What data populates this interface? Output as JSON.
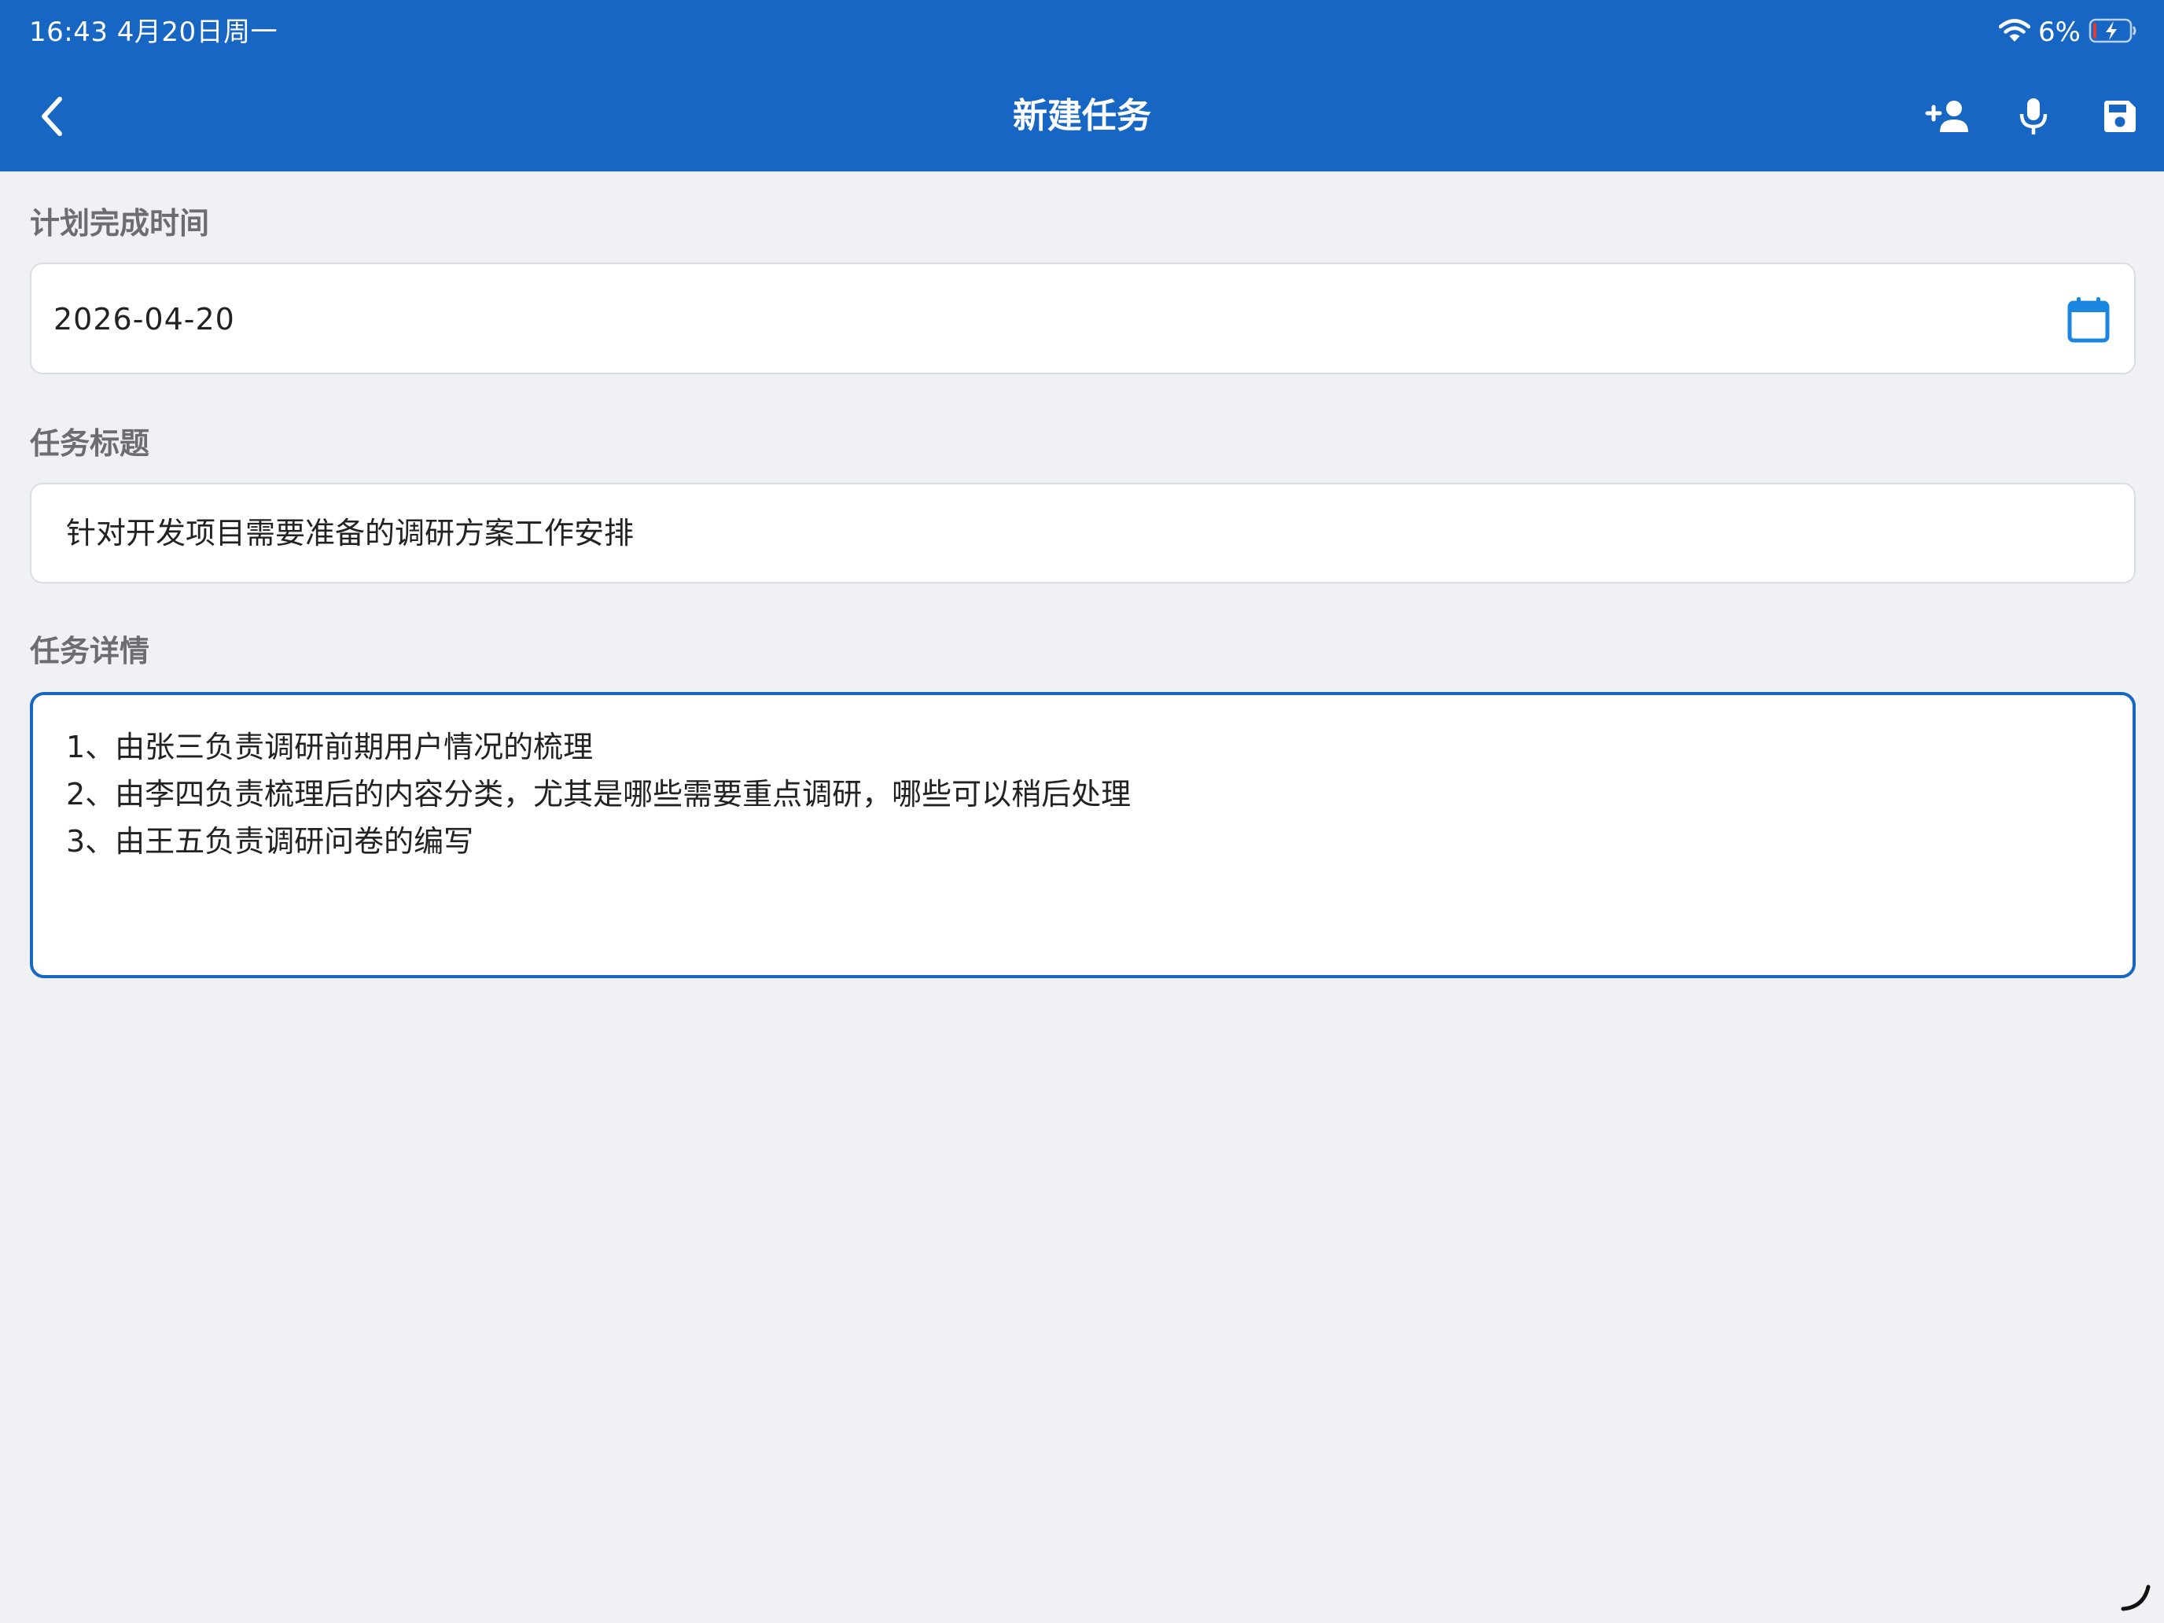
{
  "status_bar": {
    "time_date": "16:43   4月20日周一",
    "battery_percent": "6%",
    "icons": [
      "wifi-icon",
      "battery-charging-icon"
    ]
  },
  "nav": {
    "title": "新建任务",
    "back_icon": "chevron-left-icon",
    "actions": [
      "add-user-icon",
      "microphone-icon",
      "save-icon"
    ]
  },
  "form": {
    "planned_date": {
      "label": "计划完成时间",
      "value": "2026-04-20",
      "icon": "calendar-icon"
    },
    "task_title": {
      "label": "任务标题",
      "value": "针对开发项目需要准备的调研方案工作安排"
    },
    "task_detail": {
      "label": "任务详情",
      "lines": [
        "1、由张三负责调研前期用户情况的梳理",
        "2、由李四负责梳理后的内容分类，尤其是哪些需要重点调研，哪些可以稍后处理",
        "3、由王五负责调研问卷的编写"
      ]
    }
  },
  "colors": {
    "primary": "#1766c3",
    "background": "#f0f1f5",
    "label": "#6b6d72",
    "text": "#222222"
  }
}
